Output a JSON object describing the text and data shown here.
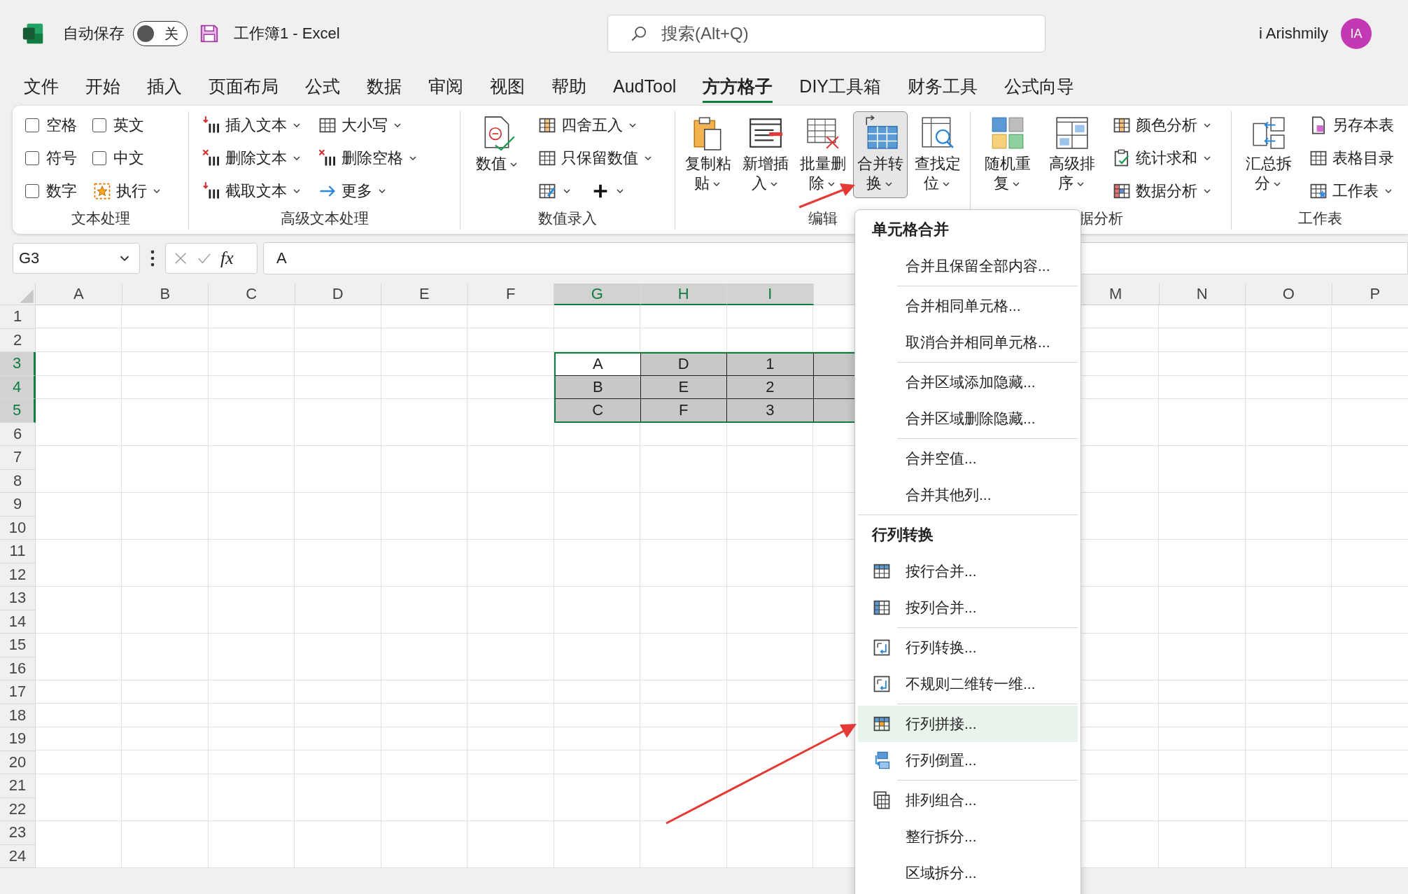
{
  "title_bar": {
    "autosave_label": "自动保存",
    "autosave_toggle": {
      "label": "关",
      "on": false
    },
    "title": "工作簿1 - Excel",
    "search": {
      "placeholder": "搜索(Alt+Q)"
    },
    "user_name": "i Arishmily",
    "avatar": "IA"
  },
  "menu_tabs": [
    {
      "label": "文件",
      "selected": false
    },
    {
      "label": "开始",
      "selected": false
    },
    {
      "label": "插入",
      "selected": false
    },
    {
      "label": "页面布局",
      "selected": false
    },
    {
      "label": "公式",
      "selected": false
    },
    {
      "label": "数据",
      "selected": false
    },
    {
      "label": "审阅",
      "selected": false
    },
    {
      "label": "视图",
      "selected": false
    },
    {
      "label": "帮助",
      "selected": false
    },
    {
      "label": "AudTool",
      "selected": false
    },
    {
      "label": "方方格子",
      "selected": true
    },
    {
      "label": "DIY工具箱",
      "selected": false
    },
    {
      "label": "财务工具",
      "selected": false
    },
    {
      "label": "公式向导",
      "selected": false
    }
  ],
  "ribbon": {
    "groups": [
      {
        "label": "文本处理",
        "columns": [
          {
            "kind": "stack",
            "items": [
              {
                "kind": "checkbox",
                "label": "空格",
                "checked": false
              },
              {
                "kind": "checkbox",
                "label": "符号",
                "checked": false
              },
              {
                "kind": "checkbox",
                "label": "数字",
                "checked": false
              }
            ]
          },
          {
            "kind": "stack",
            "items": [
              {
                "kind": "checkbox",
                "label": "英文",
                "checked": false
              },
              {
                "kind": "checkbox",
                "label": "中文",
                "checked": false
              },
              {
                "kind": "button",
                "label": "执行",
                "dropdown": true
              }
            ]
          }
        ]
      },
      {
        "label": "高级文本处理",
        "columns": [
          {
            "kind": "stack",
            "items": [
              {
                "kind": "button",
                "label": "插入文本",
                "dropdown": true
              },
              {
                "kind": "button",
                "label": "删除文本",
                "dropdown": true
              },
              {
                "kind": "button",
                "label": "截取文本",
                "dropdown": true
              }
            ]
          },
          {
            "kind": "stack",
            "items": [
              {
                "kind": "button",
                "label": "大小写",
                "dropdown": true
              },
              {
                "kind": "button",
                "label": "删除空格",
                "dropdown": true
              },
              {
                "kind": "button",
                "label": "更多",
                "dropdown": true
              }
            ]
          }
        ]
      },
      {
        "label": "数值录入",
        "columns": [
          {
            "kind": "large",
            "label": "数值",
            "dropdown": true,
            "pressed": false
          },
          {
            "kind": "stack",
            "items": [
              {
                "kind": "button",
                "label": "四舍五入",
                "dropdown": true
              },
              {
                "kind": "button",
                "label": "只保留数值",
                "dropdown": true
              },
              {
                "kind": "icon_row",
                "buttons": [
                  {
                    "dropdown": true
                  },
                  {
                    "dropdown": true
                  }
                ]
              }
            ]
          }
        ]
      },
      {
        "label": "编辑",
        "columns": [
          {
            "kind": "large",
            "label": "复制粘贴",
            "dropdown": true,
            "pressed": false
          },
          {
            "kind": "large",
            "label": "新增插入",
            "dropdown": true,
            "pressed": false
          },
          {
            "kind": "large",
            "label": "批量删除",
            "dropdown": true,
            "pressed": false
          },
          {
            "kind": "large",
            "label": "合并转换",
            "dropdown": true,
            "pressed": true
          },
          {
            "kind": "large",
            "label": "查找定位",
            "dropdown": true,
            "pressed": false
          }
        ]
      },
      {
        "label": "据分析",
        "columns": [
          {
            "kind": "large",
            "label": "随机重复",
            "dropdown": true,
            "pressed": false
          },
          {
            "kind": "large",
            "label": "高级排序",
            "dropdown": true,
            "pressed": false
          },
          {
            "kind": "stack",
            "items": [
              {
                "kind": "button",
                "label": "颜色分析",
                "dropdown": true
              },
              {
                "kind": "button",
                "label": "统计求和",
                "dropdown": true
              },
              {
                "kind": "button",
                "label": "数据分析",
                "dropdown": true
              }
            ]
          }
        ]
      },
      {
        "label": "工作表",
        "columns": [
          {
            "kind": "large",
            "label": "汇总拆分",
            "dropdown": true,
            "pressed": false
          },
          {
            "kind": "stack",
            "items": [
              {
                "kind": "button",
                "label": "另存本表",
                "dropdown": false
              },
              {
                "kind": "button",
                "label": "表格目录",
                "dropdown": false
              },
              {
                "kind": "button",
                "label": "工作表",
                "dropdown": true
              }
            ]
          }
        ]
      }
    ]
  },
  "formula_bar": {
    "name_box": "G3",
    "function_label": "fx",
    "formula": "A"
  },
  "sheet": {
    "columns": [
      {
        "label": "A",
        "selected": false
      },
      {
        "label": "B",
        "selected": false
      },
      {
        "label": "C",
        "selected": false
      },
      {
        "label": "D",
        "selected": false
      },
      {
        "label": "E",
        "selected": false
      },
      {
        "label": "F",
        "selected": false
      },
      {
        "label": "G",
        "selected": true
      },
      {
        "label": "H",
        "selected": true
      },
      {
        "label": "I",
        "selected": true
      }
    ],
    "columns_right": [
      {
        "label": "M",
        "selected": false
      },
      {
        "label": "N",
        "selected": false
      },
      {
        "label": "O",
        "selected": false
      },
      {
        "label": "P",
        "selected": false
      }
    ],
    "rows": [
      {
        "label": "1",
        "selected": false
      },
      {
        "label": "2",
        "selected": false
      },
      {
        "label": "3",
        "selected": true,
        "cells": [
          {
            "value": "A",
            "active": true
          },
          {
            "value": "D",
            "active": false
          },
          {
            "value": "1",
            "active": false
          },
          {
            "active": false
          }
        ]
      },
      {
        "label": "4",
        "selected": true,
        "cells": [
          {
            "value": "B",
            "active": false
          },
          {
            "value": "E",
            "active": false
          },
          {
            "value": "2",
            "active": false
          },
          {
            "active": false
          }
        ]
      },
      {
        "label": "5",
        "selected": true,
        "cells": [
          {
            "value": "C",
            "active": false
          },
          {
            "value": "F",
            "active": false
          },
          {
            "value": "3",
            "active": false
          },
          {
            "active": false
          }
        ]
      },
      {
        "label": "6",
        "selected": false
      },
      {
        "label": "7",
        "selected": false
      },
      {
        "label": "8",
        "selected": false
      },
      {
        "label": "9",
        "selected": false
      },
      {
        "label": "10",
        "selected": false
      },
      {
        "label": "11",
        "selected": false
      },
      {
        "label": "12",
        "selected": false
      },
      {
        "label": "13",
        "selected": false
      },
      {
        "label": "14",
        "selected": false
      },
      {
        "label": "15",
        "selected": false
      },
      {
        "label": "16",
        "selected": false
      },
      {
        "label": "17",
        "selected": false
      },
      {
        "label": "18",
        "selected": false
      },
      {
        "label": "19",
        "selected": false
      },
      {
        "label": "20",
        "selected": false
      },
      {
        "label": "21",
        "selected": false
      },
      {
        "label": "22",
        "selected": false
      },
      {
        "label": "23",
        "selected": false
      },
      {
        "label": "24",
        "selected": false
      }
    ]
  },
  "dropdown_menu": {
    "sections": [
      {
        "title": "单元格合并",
        "groups": [
          [
            {
              "label": "合并且保留全部内容...",
              "kind": "text",
              "selected": false
            }
          ],
          [
            {
              "label": "合并相同单元格...",
              "kind": "text",
              "selected": false
            },
            {
              "label": "取消合并相同单元格...",
              "kind": "text",
              "selected": false
            }
          ],
          [
            {
              "label": "合并区域添加隐藏...",
              "kind": "text",
              "selected": false
            },
            {
              "label": "合并区域删除隐藏...",
              "kind": "text",
              "selected": false
            }
          ],
          [
            {
              "label": "合并空值...",
              "kind": "text",
              "selected": false
            },
            {
              "label": "合并其他列...",
              "kind": "text",
              "selected": false
            }
          ]
        ]
      },
      {
        "title": "行列转换",
        "groups": [
          [
            {
              "label": "按行合并...",
              "kind": "icon",
              "selected": false
            },
            {
              "label": "按列合并...",
              "kind": "icon",
              "selected": false
            }
          ],
          [
            {
              "label": "行列转换...",
              "kind": "icon",
              "selected": false
            },
            {
              "label": "不规则二维转一维...",
              "kind": "icon",
              "selected": false
            }
          ],
          [
            {
              "label": "行列拼接...",
              "kind": "icon",
              "selected": true
            },
            {
              "label": "行列倒置...",
              "kind": "icon",
              "selected": false
            }
          ],
          [
            {
              "label": "排列组合...",
              "kind": "icon",
              "selected": false
            },
            {
              "label": "整行拆分...",
              "kind": "text",
              "selected": false
            },
            {
              "label": "区域拆分...",
              "kind": "text",
              "selected": false
            }
          ]
        ]
      }
    ]
  }
}
